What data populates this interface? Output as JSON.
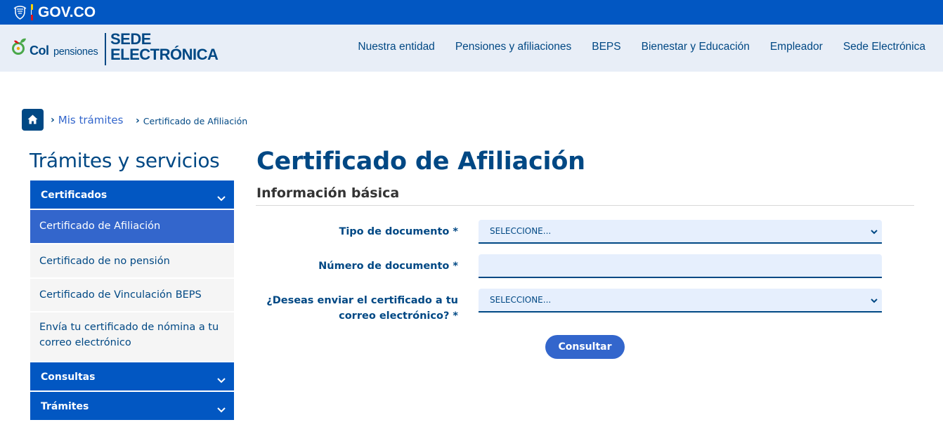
{
  "govbar": {
    "brand": "GOV.CO",
    "colors": [
      "#f9d006",
      "#0257c2",
      "#e1111b"
    ]
  },
  "header": {
    "logo": {
      "col": "Col",
      "pensiones": "pensiones",
      "sede_line1": "SEDE",
      "sede_line2": "ELECTRÓNICA"
    },
    "nav": [
      "Nuestra entidad",
      "Pensiones y afiliaciones",
      "BEPS",
      "Bienestar y Educación",
      "Empleador",
      "Sede Electrónica"
    ]
  },
  "breadcrumb": {
    "home_icon": "home-icon",
    "link": "Mis trámites",
    "current": "Certificado de Afiliación"
  },
  "sidebar": {
    "title": "Trámites y servicios",
    "sections": [
      {
        "label": "Certificados",
        "items": [
          "Certificado de Afiliación",
          "Certificado de no pensión",
          "Certificado de Vinculación BEPS",
          "Envía tu certificado de nómina a tu correo electrónico"
        ],
        "active": "Certificado de Afiliación"
      },
      {
        "label": "Consultas"
      },
      {
        "label": "Trámites"
      }
    ]
  },
  "main": {
    "title": "Certificado de Afiliación",
    "subtitle": "Información básica",
    "form": {
      "doc_type_label": "Tipo de documento *",
      "doc_type_value": "SELECCIONE...",
      "doc_number_label": "Número de documento *",
      "doc_number_value": "",
      "email_label_line1": "¿Deseas enviar el certificado a tu",
      "email_label_line2": "correo electrónico? *",
      "email_value": "SELECCIONE...",
      "submit": "Consultar"
    }
  },
  "colors": {
    "primary": "#004884",
    "accent": "#3366cc",
    "govblue": "#0257c2",
    "field_bg": "#e6effd",
    "header_bg": "#e8eef7"
  }
}
